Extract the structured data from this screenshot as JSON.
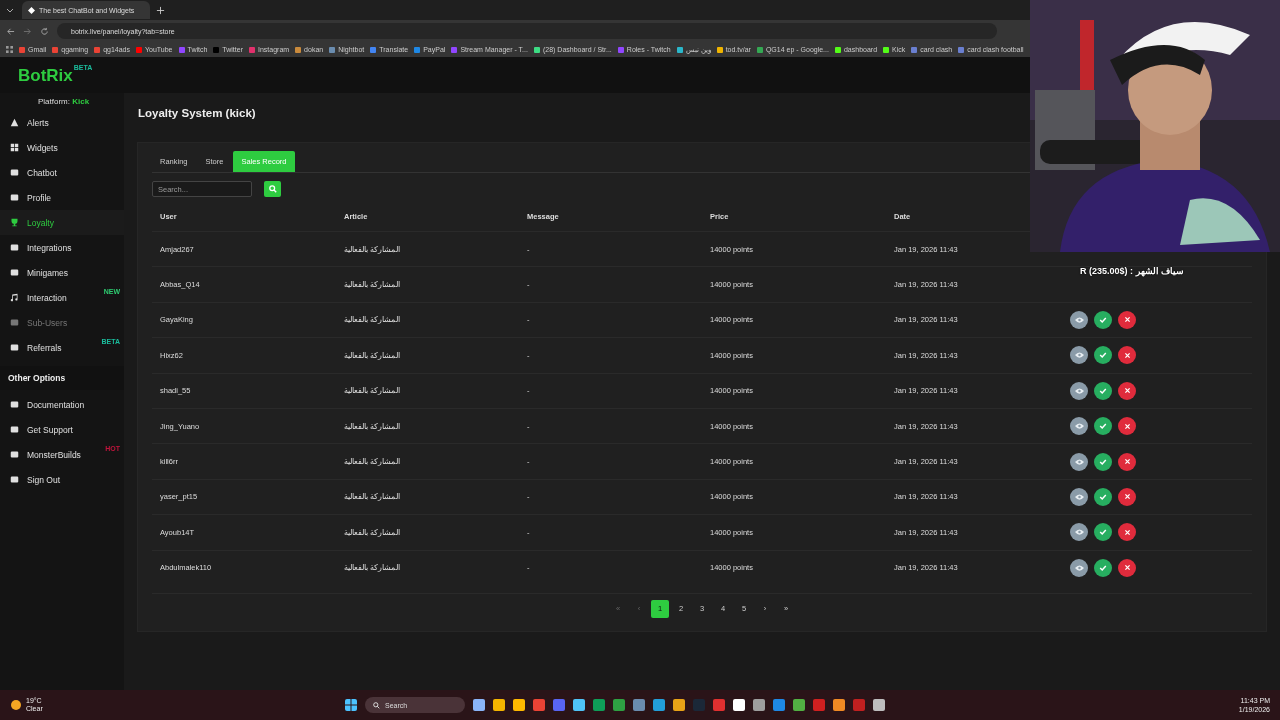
{
  "browser": {
    "tab_title": "The best ChatBot and Widgets",
    "url": "botrix.live/panel/loyalty?tab=store",
    "bookmarks": [
      "Gmail",
      "qgaming",
      "qg14ads",
      "YouTube",
      "Twitch",
      "Twitter",
      "Instagram",
      "dokan",
      "Nightbot",
      "Translate",
      "PayPal",
      "Stream Manager - T...",
      "(28) Dashboard / Str...",
      "Roles - Twitch",
      "وين نبس",
      "tod.tv/ar",
      "QG14 ep - Google...",
      "dashboard",
      "Kick",
      "card clash",
      "card clash football"
    ]
  },
  "logo": {
    "name": "BotRix",
    "badge": "BETA"
  },
  "platform": {
    "label": "Platform:",
    "value": "Kick"
  },
  "sidebar": {
    "items": [
      {
        "label": "Alerts",
        "selected": false,
        "disabled": false
      },
      {
        "label": "Widgets",
        "selected": false,
        "disabled": false
      },
      {
        "label": "Chatbot",
        "selected": false,
        "disabled": false
      },
      {
        "label": "Profile",
        "selected": false,
        "disabled": false
      },
      {
        "label": "Loyalty",
        "selected": true,
        "disabled": false
      },
      {
        "label": "Integrations",
        "selected": false,
        "disabled": false
      },
      {
        "label": "Minigames",
        "selected": false,
        "disabled": false
      },
      {
        "label": "Interaction",
        "selected": false,
        "disabled": false,
        "badge": "NEW",
        "color": "#2ecc71"
      },
      {
        "label": "Sub-Users",
        "selected": false,
        "disabled": true
      },
      {
        "label": "Referrals",
        "selected": false,
        "disabled": false,
        "badge": "BETA",
        "color": "#1abc9c"
      }
    ],
    "section": "Other Options",
    "other_items": [
      {
        "label": "Documentation"
      },
      {
        "label": "Get Support"
      },
      {
        "label": "MonsterBuilds",
        "badge": "HOT",
        "color": "#c0143c"
      },
      {
        "label": "Sign Out"
      }
    ]
  },
  "page_title": "Loyalty System (kick)",
  "tabs": [
    {
      "label": "Ranking",
      "selected": false
    },
    {
      "label": "Store",
      "selected": false
    },
    {
      "label": "Sales Record",
      "selected": true
    }
  ],
  "search": {
    "placeholder": "Search..."
  },
  "table": {
    "columns": [
      "User",
      "Article",
      "Message",
      "Price",
      "Date"
    ],
    "rows": [
      {
        "user": "Amjad267",
        "article": "المشاركة بالفعالية",
        "message": "-",
        "price": "14000 points",
        "date": "Jan 19, 2026 11:43",
        "actions_shown": false
      },
      {
        "user": "Abbas_Q14",
        "article": "المشاركة بالفعالية",
        "message": "-",
        "price": "14000 points",
        "date": "Jan 19, 2026 11:43",
        "actions_shown": false
      },
      {
        "user": "GayaKing",
        "article": "المشاركة بالفعالية",
        "message": "-",
        "price": "14000 points",
        "date": "Jan 19, 2026 11:43",
        "actions_shown": true
      },
      {
        "user": "Hixz62",
        "article": "المشاركة بالفعالية",
        "message": "-",
        "price": "14000 points",
        "date": "Jan 19, 2026 11:43",
        "actions_shown": true
      },
      {
        "user": "shadi_55",
        "article": "المشاركة بالفعالية",
        "message": "-",
        "price": "14000 points",
        "date": "Jan 19, 2026 11:43",
        "actions_shown": true
      },
      {
        "user": "Jing_Yuano",
        "article": "المشاركة بالفعالية",
        "message": "-",
        "price": "14000 points",
        "date": "Jan 19, 2026 11:43",
        "actions_shown": true
      },
      {
        "user": "kill6rr",
        "article": "المشاركة بالفعالية",
        "message": "-",
        "price": "14000 points",
        "date": "Jan 19, 2026 11:43",
        "actions_shown": true
      },
      {
        "user": "yaser_pt15",
        "article": "المشاركة بالفعالية",
        "message": "-",
        "price": "14000 points",
        "date": "Jan 19, 2026 11:43",
        "actions_shown": true
      },
      {
        "user": "Ayoub14T",
        "article": "المشاركة بالفعالية",
        "message": "-",
        "price": "14000 points",
        "date": "Jan 19, 2026 11:43",
        "actions_shown": true
      },
      {
        "user": "Abdulmalek110",
        "article": "المشاركة بالفعالية",
        "message": "-",
        "price": "14000 points",
        "date": "Jan 19, 2026 11:43",
        "actions_shown": true
      }
    ]
  },
  "pagination": {
    "first": {
      "label": "«",
      "disabled": true
    },
    "prev": {
      "label": "‹",
      "disabled": true
    },
    "pages": [
      {
        "label": "1",
        "selected": true
      },
      {
        "label": "2",
        "selected": false
      },
      {
        "label": "3",
        "selected": false
      },
      {
        "label": "4",
        "selected": false
      },
      {
        "label": "5",
        "selected": false
      }
    ],
    "next": {
      "label": "›",
      "disabled": false
    },
    "last": {
      "label": "»",
      "disabled": false
    }
  },
  "stream_overlay": {
    "kind": "picture",
    "caption": "سياف الشهر : ($235.00) R"
  },
  "taskbar": {
    "weather_temp": "19°C",
    "weather_text": "Clear",
    "search": "Search",
    "time": "11:43 PM",
    "date": "1/19/2026"
  }
}
